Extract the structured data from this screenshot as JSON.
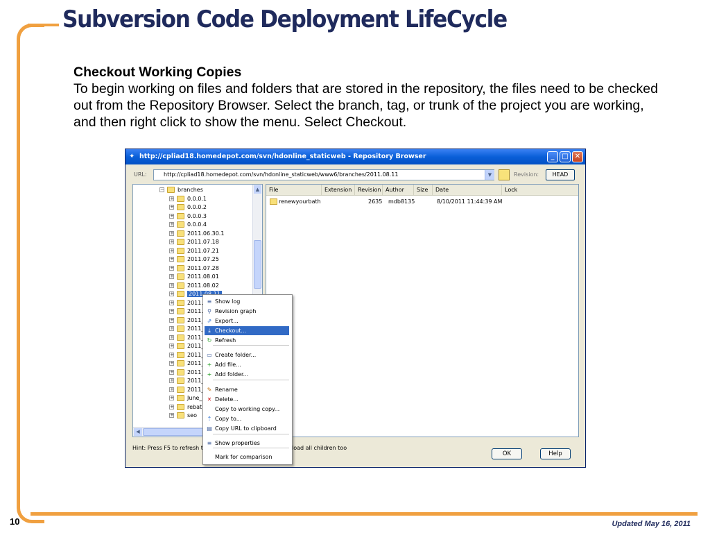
{
  "slide": {
    "title": "Subversion Code Deployment LifeCycle",
    "heading": "Checkout Working Copies",
    "body": "To begin working on files and folders that are stored in the repository, the files need to be checked out from the Repository Browser. Select the branch, tag, or trunk of the project you are working, and then right click to show the menu. Select Checkout.",
    "page_number": "10",
    "updated": "Updated May 16, 2011",
    "accent_color": "#f0a040",
    "title_color": "#1f2a5c"
  },
  "window": {
    "title": "http://cpliad18.homedepot.com/svn/hdonline_staticweb - Repository Browser",
    "url_label": "URL:",
    "url_value": "http://cpliad18.homedepot.com/svn/hdonline_staticweb/www6/branches/2011.08.11",
    "revision_label": "Revision:",
    "revision_button": "HEAD",
    "titlebar_color": "#0a5fd8"
  },
  "tree": {
    "root": "branches",
    "items": [
      "0.0.0.1",
      "0.0.0.2",
      "0.0.0.3",
      "0.0.0.4",
      "2011.06.30.1",
      "2011.07.18",
      "2011.07.21",
      "2011.07.25",
      "2011.07.28",
      "2011.08.01",
      "2011.08.02",
      "2011.08.11",
      "2011.",
      "2011.",
      "2011_",
      "2011_",
      "2011_",
      "2011_",
      "2011_",
      "2011_",
      "2011_",
      "2011_",
      "2011_",
      "June_",
      "rebat",
      "seo"
    ],
    "selected": "2011.08.11"
  },
  "list": {
    "columns": [
      "File",
      "Extension",
      "Revision",
      "Author",
      "Size",
      "Date",
      "Lock"
    ],
    "rows": [
      {
        "file": "renewyourbath",
        "extension": "",
        "revision": "2635",
        "author": "mdb8135",
        "size": "",
        "date": "8/10/2011 11:44:39 AM",
        "lock": ""
      }
    ]
  },
  "watermark_text": "http",
  "hint": {
    "left": "Hint: Press F5 to refresh th",
    "right": "load all children too"
  },
  "buttons": {
    "ok": "OK",
    "help": "Help"
  },
  "context_menu": {
    "items": [
      {
        "label": "Show log",
        "icon": "show-log-icon"
      },
      {
        "label": "Revision graph",
        "icon": "revision-graph-icon"
      },
      {
        "label": "Export...",
        "icon": "export-icon"
      },
      {
        "label": "Checkout...",
        "icon": "checkout-icon",
        "highlighted": true
      },
      {
        "label": "Refresh",
        "icon": "refresh-icon"
      },
      {
        "label": "Create folder...",
        "icon": "create-folder-icon"
      },
      {
        "label": "Add file...",
        "icon": "add-file-icon"
      },
      {
        "label": "Add folder...",
        "icon": "add-folder-icon"
      },
      {
        "label": "Rename",
        "icon": "rename-icon"
      },
      {
        "label": "Delete...",
        "icon": "delete-icon"
      },
      {
        "label": "Copy to working copy...",
        "icon": ""
      },
      {
        "label": "Copy to...",
        "icon": "copy-to-icon"
      },
      {
        "label": "Copy URL to clipboard",
        "icon": "clipboard-icon"
      },
      {
        "label": "Show properties",
        "icon": "properties-icon"
      },
      {
        "label": "Mark for comparison",
        "icon": ""
      }
    ]
  }
}
